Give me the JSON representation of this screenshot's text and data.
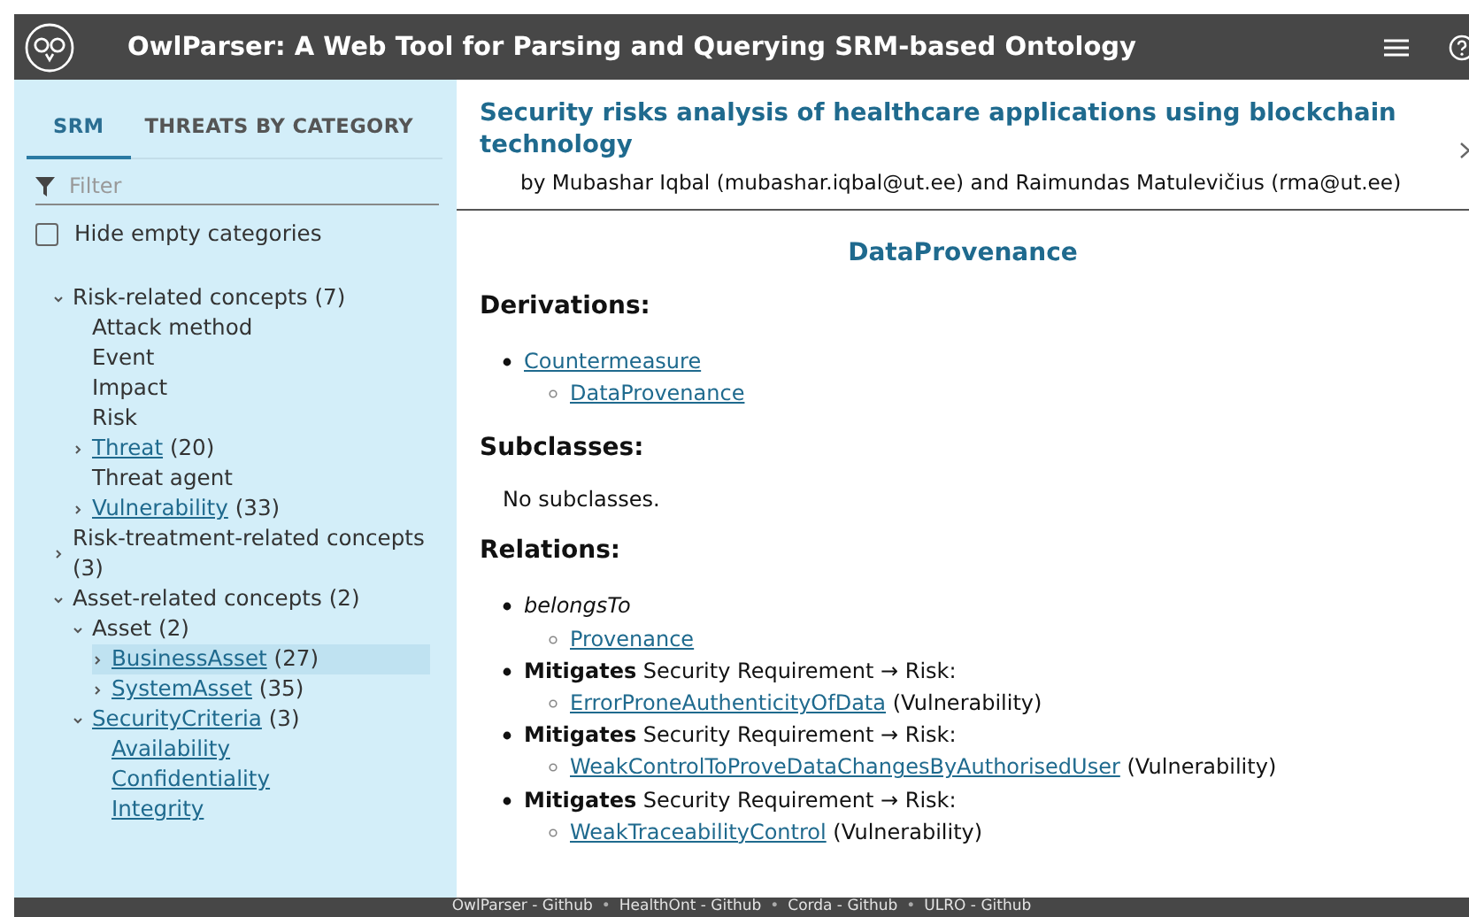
{
  "header": {
    "title": "OwlParser: A Web Tool for Parsing and Querying SRM-based Ontology"
  },
  "sidebar": {
    "tabs": [
      {
        "label": "SRM",
        "selected": true
      },
      {
        "label": "THREATS BY CATEGORY",
        "selected": false
      }
    ],
    "filter": {
      "placeholder": "Filter"
    },
    "hide_empty": {
      "label": "Hide empty categories",
      "checked": false
    },
    "tree": [
      {
        "label": "Risk-related concepts",
        "count": "(7)",
        "link": false,
        "selected": false,
        "expanded": true,
        "children": [
          {
            "label": "Attack method",
            "link": false,
            "selected": false
          },
          {
            "label": "Event",
            "link": false,
            "selected": false
          },
          {
            "label": "Impact",
            "link": false,
            "selected": false
          },
          {
            "label": "Risk",
            "link": false,
            "selected": false
          },
          {
            "label": "Threat",
            "count": "(20)",
            "link": true,
            "selected": false,
            "expanded": false
          },
          {
            "label": "Threat agent",
            "link": false,
            "selected": false
          },
          {
            "label": "Vulnerability",
            "count": "(33)",
            "link": true,
            "selected": false,
            "expanded": false
          }
        ]
      },
      {
        "label": "Risk-treatment-related concepts",
        "count": "(3)",
        "link": false,
        "selected": false,
        "expanded": false
      },
      {
        "label": "Asset-related concepts",
        "count": "(2)",
        "link": false,
        "selected": false,
        "expanded": true,
        "children": [
          {
            "label": "Asset",
            "count": "(2)",
            "link": false,
            "selected": false,
            "expanded": true,
            "children": [
              {
                "label": "BusinessAsset",
                "count": "(27)",
                "link": true,
                "selected": true,
                "expanded": false
              },
              {
                "label": "SystemAsset",
                "count": "(35)",
                "link": true,
                "selected": false,
                "expanded": false
              }
            ]
          },
          {
            "label": "SecurityCriteria",
            "count": "(3)",
            "link": true,
            "selected": false,
            "expanded": true,
            "children": [
              {
                "label": "Availability",
                "link": true,
                "selected": false
              },
              {
                "label": "Confidentiality",
                "link": true,
                "selected": false
              },
              {
                "label": "Integrity",
                "link": true,
                "selected": false
              }
            ]
          }
        ]
      }
    ]
  },
  "main": {
    "title": "Security risks analysis of healthcare applications using blockchain technology",
    "authors": "by Mubashar Iqbal (mubashar.iqbal@ut.ee) and Raimundas Matulevičius (rma@ut.ee)",
    "entity": "DataProvenance",
    "derivations": {
      "heading": "Derivations:",
      "items": [
        {
          "label": "Countermeasure",
          "children": [
            {
              "label": "DataProvenance"
            }
          ]
        }
      ]
    },
    "subclasses": {
      "heading": "Subclasses:",
      "text": "No subclasses."
    },
    "relations": {
      "heading": "Relations:",
      "items": [
        {
          "kind": "property",
          "text": "belongsTo",
          "targets": [
            {
              "label": "Provenance"
            }
          ]
        },
        {
          "kind": "rule",
          "text": "**Mitigates** Security Requirement → Risk:",
          "targets": [
            {
              "label": "ErrorProneAuthenticityOfData",
              "type": "(Vulnerability)"
            }
          ]
        },
        {
          "kind": "rule",
          "text": "**Mitigates** Security Requirement → Risk:",
          "targets": [
            {
              "label": "WeakControlToProveDataChangesByAuthorisedUser",
              "type": "(Vulnerability)"
            }
          ]
        },
        {
          "kind": "rule",
          "text": "**Mitigates** Security Requirement → Risk:",
          "targets": [
            {
              "label": "WeakTraceabilityControl",
              "type": "(Vulnerability)"
            }
          ]
        }
      ]
    }
  },
  "footer": [
    {
      "kind": "link",
      "label": "OwlParser - Github"
    },
    {
      "kind": "separator",
      "label": "•"
    },
    {
      "kind": "link",
      "label": "HealthOnt - Github"
    },
    {
      "kind": "separator",
      "label": "•"
    },
    {
      "kind": "link",
      "label": "Corda - Github"
    },
    {
      "kind": "separator",
      "label": "•"
    },
    {
      "kind": "link",
      "label": "ULRO - Github"
    }
  ]
}
